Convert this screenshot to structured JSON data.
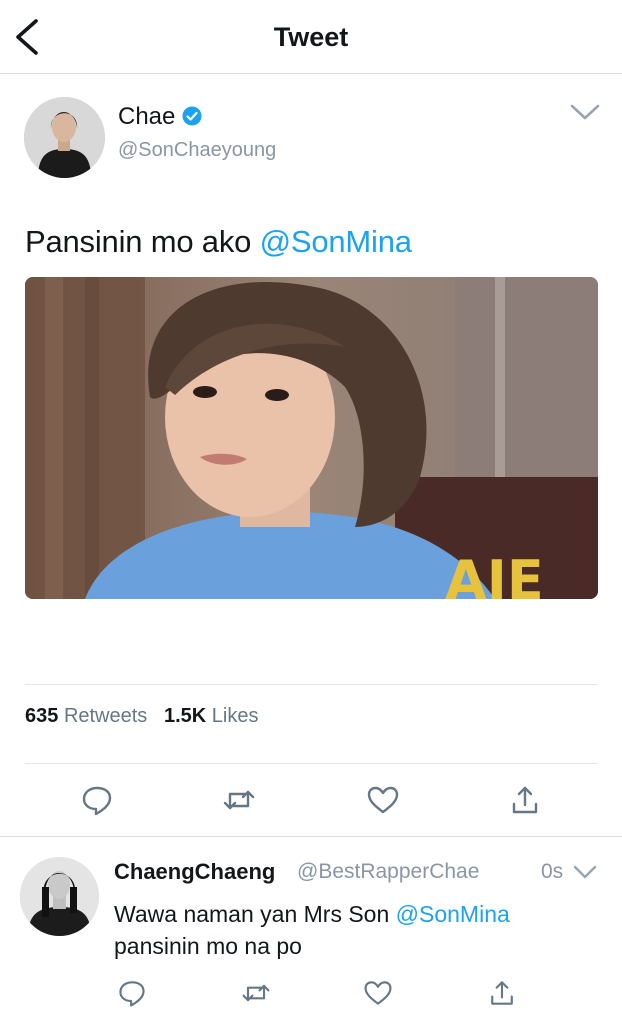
{
  "header": {
    "title": "Tweet"
  },
  "tweet": {
    "author_name": "Chae",
    "author_handle": "@SonChaeyoung",
    "text_prefix": "Pansinin mo ako",
    "mention": "@SonMina",
    "retweets_count": "635",
    "retweets_label": "Retweets",
    "likes_count": "1.5K",
    "likes_label": "Likes"
  },
  "reply": {
    "author_name": "ChaengChaeng",
    "author_handle": "@BestRapperChae",
    "time": "0s",
    "text_prefix": "Wawa naman yan Mrs Son",
    "mention": "@SonMina",
    "text_suffix": "pansinin mo na po"
  },
  "icons": {
    "back": "chevron-left-icon",
    "verified": "verified-badge-icon",
    "more": "chevron-down-icon",
    "reply": "reply-icon",
    "retweet": "retweet-icon",
    "like": "heart-icon",
    "share": "share-icon"
  },
  "colors": {
    "accent": "#1da1f2",
    "secondary_text": "#8a96a3",
    "icon_gray": "#657786",
    "divider": "#e1e6ea"
  }
}
